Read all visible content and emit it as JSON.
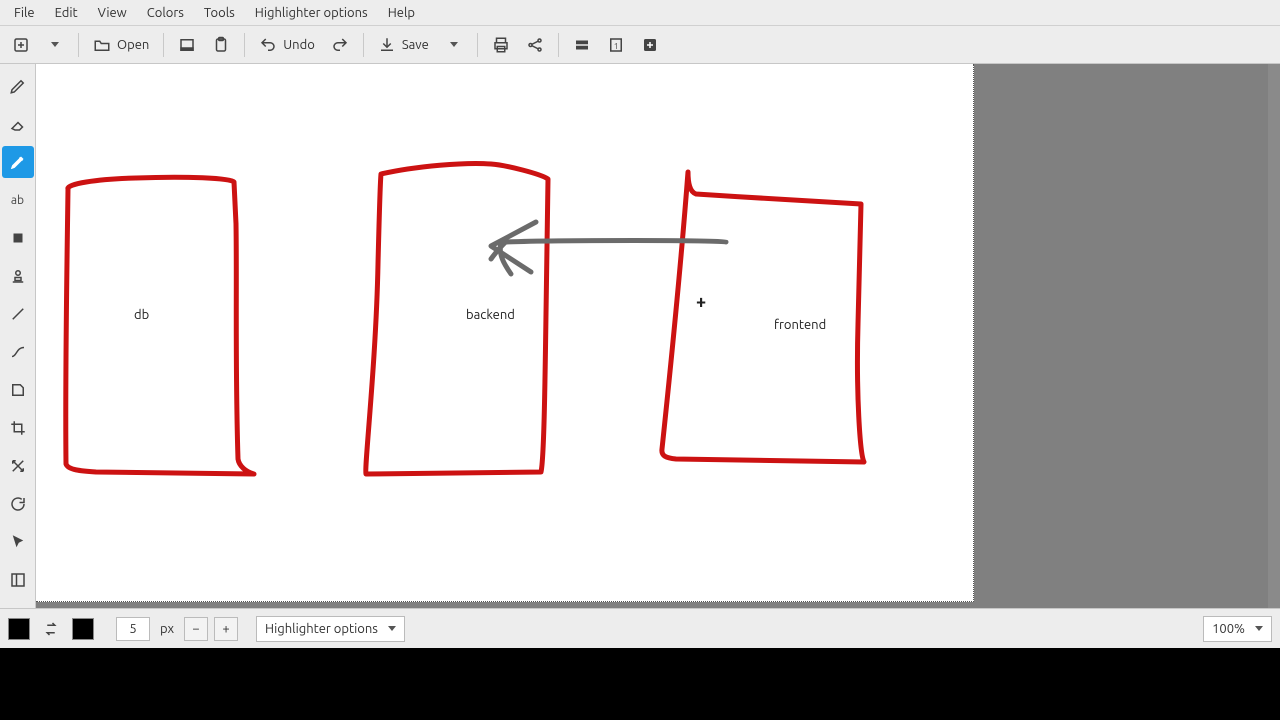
{
  "menubar": [
    "File",
    "Edit",
    "View",
    "Colors",
    "Tools",
    "Highlighter options",
    "Help"
  ],
  "toolbar": {
    "open_label": "Open",
    "undo_label": "Undo",
    "save_label": "Save"
  },
  "left_tools": [
    {
      "name": "pen-tool-icon"
    },
    {
      "name": "eraser-tool-icon"
    },
    {
      "name": "highlighter-tool-icon",
      "active": true
    },
    {
      "name": "text-tool-icon",
      "glyph": "ab"
    },
    {
      "name": "pixel-tool-icon"
    },
    {
      "name": "stamp-tool-icon"
    },
    {
      "name": "line-tool-icon"
    },
    {
      "name": "curve-tool-icon"
    },
    {
      "name": "shape-tool-icon"
    },
    {
      "name": "crop-tool-icon"
    },
    {
      "name": "move-tool-icon"
    },
    {
      "name": "reload-tool-icon"
    },
    {
      "name": "pointer-tool-icon"
    },
    {
      "name": "panel-tool-icon"
    }
  ],
  "canvas": {
    "labels": {
      "db": "db",
      "backend": "backend",
      "frontend": "frontend"
    },
    "cursor_glyph": "+"
  },
  "footer": {
    "stroke_width_value": "5",
    "stroke_width_unit": "px",
    "minus_glyph": "−",
    "plus_glyph": "+",
    "options_label": "Highlighter options",
    "zoom_label": "100%"
  }
}
